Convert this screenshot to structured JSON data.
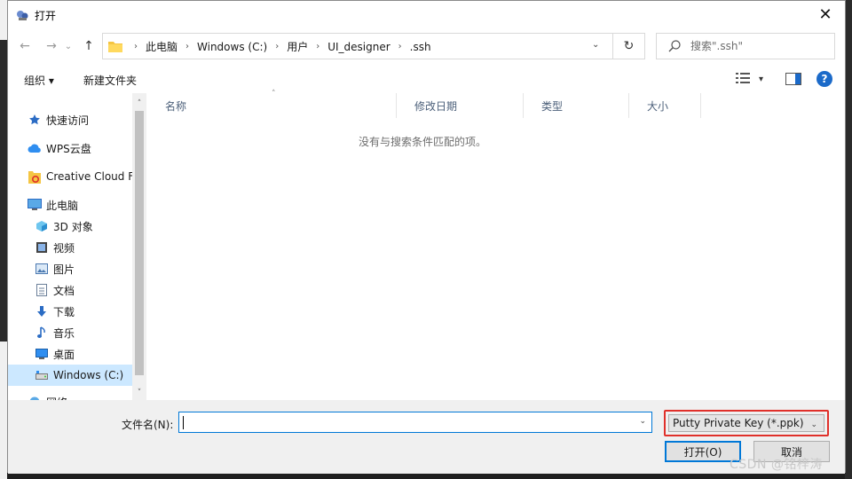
{
  "window": {
    "title": "打开",
    "close_glyph": "✕"
  },
  "nav": {
    "back_glyph": "←",
    "forward_glyph": "→",
    "recent_glyph": "⌄",
    "up_glyph": "↑",
    "breadcrumbs": [
      "此电脑",
      "Windows (C:)",
      "用户",
      "UI_designer",
      ".ssh"
    ],
    "separator": "›",
    "dropdown_glyph": "⌄",
    "refresh_glyph": "↻"
  },
  "search": {
    "placeholder": "搜索\".ssh\""
  },
  "toolbar": {
    "organize_label": "组织 ▾",
    "new_folder_label": "新建文件夹",
    "view_dropdown_glyph": "▾",
    "help_label": "?"
  },
  "sidebar": {
    "items": [
      {
        "label": "快速访问",
        "icon": "star-icon"
      },
      {
        "label": "WPS云盘",
        "icon": "cloud-icon"
      },
      {
        "label": "Creative Cloud Files",
        "icon": "creative-cloud-icon"
      },
      {
        "label": "此电脑",
        "icon": "computer-icon"
      },
      {
        "label": "3D 对象",
        "icon": "cube-icon"
      },
      {
        "label": "视频",
        "icon": "video-icon"
      },
      {
        "label": "图片",
        "icon": "picture-icon"
      },
      {
        "label": "文档",
        "icon": "document-icon"
      },
      {
        "label": "下载",
        "icon": "download-icon"
      },
      {
        "label": "音乐",
        "icon": "music-icon"
      },
      {
        "label": "桌面",
        "icon": "desktop-icon"
      },
      {
        "label": "Windows (C:)",
        "icon": "drive-icon"
      },
      {
        "label": "网络",
        "icon": "network-icon"
      }
    ],
    "selected": "Windows (C:)",
    "scroll_up": "˄",
    "scroll_down": "˅"
  },
  "filelist": {
    "columns": [
      "名称",
      "修改日期",
      "类型",
      "大小"
    ],
    "sort_glyph": "˄",
    "empty_message": "没有与搜索条件匹配的项。"
  },
  "footer": {
    "filename_label": "文件名(N):",
    "filename_value": "",
    "filename_dropdown": "⌄",
    "filetype_value": "Putty Private Key (*.ppk)",
    "filetype_dropdown": "⌄",
    "open_label": "打开(O)",
    "cancel_label": "取消"
  },
  "watermark": "CSDN @铭梓涛",
  "colors": {
    "accent": "#0078d7",
    "highlight_border": "#e0302a",
    "selected_bg": "#cce8ff"
  }
}
